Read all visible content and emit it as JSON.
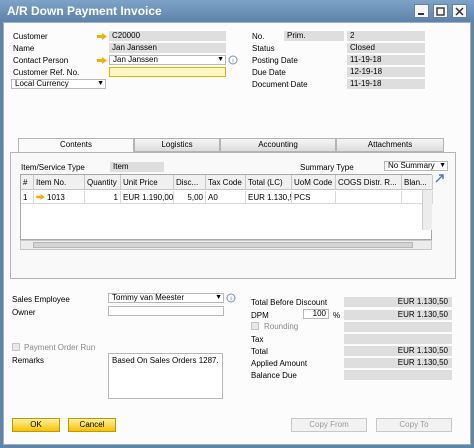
{
  "window": {
    "title": "A/R Down Payment Invoice"
  },
  "header_left": {
    "customer": {
      "label": "Customer",
      "value": "C20000"
    },
    "name": {
      "label": "Name",
      "value": "Jan Janssen"
    },
    "contact_person": {
      "label": "Contact Person",
      "value": "Jan Janssen"
    },
    "customer_ref": {
      "label": "Customer Ref. No.",
      "value": ""
    },
    "currency": {
      "value": "Local Currency"
    }
  },
  "header_right": {
    "no": {
      "label": "No.",
      "series": "Prim.",
      "value": "2"
    },
    "status": {
      "label": "Status",
      "value": "Closed"
    },
    "posting_date": {
      "label": "Posting Date",
      "value": "11-19-18"
    },
    "due_date": {
      "label": "Due Date",
      "value": "12-19-18"
    },
    "document_date": {
      "label": "Document Date",
      "value": "11-19-18"
    }
  },
  "tabs": [
    {
      "label": "Contents"
    },
    {
      "label": "Logistics"
    },
    {
      "label": "Accounting"
    },
    {
      "label": "Attachments"
    }
  ],
  "contents": {
    "item_service_type_label": "Item/Service Type",
    "item_service_type_value": "Item",
    "summary_type_label": "Summary Type",
    "summary_type_value": "No Summary",
    "columns": [
      "#",
      "Item No.",
      "Quantity",
      "Unit Price",
      "Disc...",
      "Tax Code",
      "Total (LC)",
      "UoM Code",
      "COGS Distr. R...",
      "Blan..."
    ],
    "rows": [
      [
        "1",
        "1013",
        "1",
        "EUR 1.190,00",
        "5,00",
        "A0",
        "EUR 1.130,50",
        "PCS",
        "",
        ""
      ]
    ]
  },
  "footer_left": {
    "sales_employee": {
      "label": "Sales Employee",
      "value": "Tommy van Meester"
    },
    "owner": {
      "label": "Owner",
      "value": ""
    },
    "payment_order_run": {
      "label": "Payment Order Run"
    },
    "remarks": {
      "label": "Remarks",
      "value": "Based On Sales Orders 1287."
    }
  },
  "totals": {
    "total_before_discount": {
      "label": "Total Before Discount",
      "value": "EUR 1.130,50"
    },
    "dpm": {
      "label": "DPM",
      "percent": "100",
      "percent_sign": "%",
      "value": "EUR 1.130,50"
    },
    "rounding": {
      "label": "Rounding",
      "value": ""
    },
    "tax": {
      "label": "Tax",
      "value": ""
    },
    "total": {
      "label": "Total",
      "value": "EUR 1.130,50"
    },
    "applied_amount": {
      "label": "Applied Amount",
      "value": "EUR 1.130,50"
    },
    "balance_due": {
      "label": "Balance Due",
      "value": ""
    }
  },
  "buttons": {
    "ok": "OK",
    "cancel": "Cancel",
    "copy_from": "Copy From",
    "copy_to": "Copy To"
  },
  "colors": {
    "title_bar": "#5f85ac",
    "accent_yellow": "#f6c200",
    "link_arrow": "#f0b000"
  }
}
